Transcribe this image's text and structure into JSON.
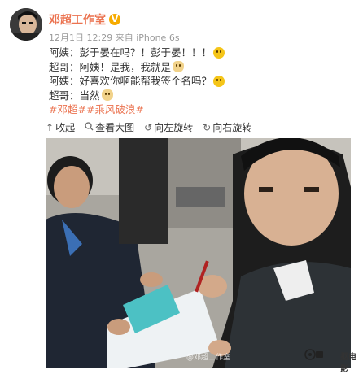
{
  "account": {
    "name": "邓超工作室",
    "verified_icon": "verified-v-icon"
  },
  "meta": {
    "time": "12月1日 12:29",
    "source": "来自 iPhone 6s"
  },
  "post": {
    "line1": "阿姨：彭于晏在吗？！彭于晏！！！",
    "line2": "超哥：阿姨！是我，我就是",
    "line3": "阿姨：好喜欢你啊能帮我签个名吗？",
    "line4": "超哥：当然",
    "tags": "#邓超##乘风破浪#"
  },
  "toolbar": {
    "collapse_label": "收起",
    "view_large_label": "查看大图",
    "rotate_left_label": "向左旋转",
    "rotate_right_label": "向右旋转"
  },
  "photo": {
    "watermark": "@邓超工作室"
  },
  "overlay_watermark": {
    "label": "抠电影"
  },
  "colors": {
    "name": "#eb7350",
    "tags": "#eb7350",
    "verified": "#f6ab00"
  }
}
